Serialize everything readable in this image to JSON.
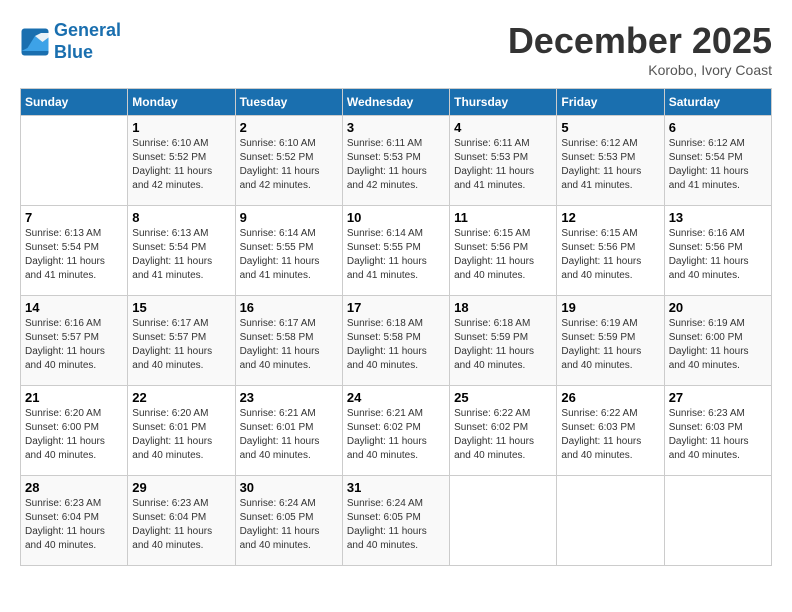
{
  "header": {
    "logo_line1": "General",
    "logo_line2": "Blue",
    "month": "December 2025",
    "location": "Korobo, Ivory Coast"
  },
  "days_of_week": [
    "Sunday",
    "Monday",
    "Tuesday",
    "Wednesday",
    "Thursday",
    "Friday",
    "Saturday"
  ],
  "weeks": [
    [
      {
        "day": "",
        "sunrise": "",
        "sunset": "",
        "daylight": ""
      },
      {
        "day": "1",
        "sunrise": "Sunrise: 6:10 AM",
        "sunset": "Sunset: 5:52 PM",
        "daylight": "Daylight: 11 hours and 42 minutes."
      },
      {
        "day": "2",
        "sunrise": "Sunrise: 6:10 AM",
        "sunset": "Sunset: 5:52 PM",
        "daylight": "Daylight: 11 hours and 42 minutes."
      },
      {
        "day": "3",
        "sunrise": "Sunrise: 6:11 AM",
        "sunset": "Sunset: 5:53 PM",
        "daylight": "Daylight: 11 hours and 42 minutes."
      },
      {
        "day": "4",
        "sunrise": "Sunrise: 6:11 AM",
        "sunset": "Sunset: 5:53 PM",
        "daylight": "Daylight: 11 hours and 41 minutes."
      },
      {
        "day": "5",
        "sunrise": "Sunrise: 6:12 AM",
        "sunset": "Sunset: 5:53 PM",
        "daylight": "Daylight: 11 hours and 41 minutes."
      },
      {
        "day": "6",
        "sunrise": "Sunrise: 6:12 AM",
        "sunset": "Sunset: 5:54 PM",
        "daylight": "Daylight: 11 hours and 41 minutes."
      }
    ],
    [
      {
        "day": "7",
        "sunrise": "Sunrise: 6:13 AM",
        "sunset": "Sunset: 5:54 PM",
        "daylight": "Daylight: 11 hours and 41 minutes."
      },
      {
        "day": "8",
        "sunrise": "Sunrise: 6:13 AM",
        "sunset": "Sunset: 5:54 PM",
        "daylight": "Daylight: 11 hours and 41 minutes."
      },
      {
        "day": "9",
        "sunrise": "Sunrise: 6:14 AM",
        "sunset": "Sunset: 5:55 PM",
        "daylight": "Daylight: 11 hours and 41 minutes."
      },
      {
        "day": "10",
        "sunrise": "Sunrise: 6:14 AM",
        "sunset": "Sunset: 5:55 PM",
        "daylight": "Daylight: 11 hours and 41 minutes."
      },
      {
        "day": "11",
        "sunrise": "Sunrise: 6:15 AM",
        "sunset": "Sunset: 5:56 PM",
        "daylight": "Daylight: 11 hours and 40 minutes."
      },
      {
        "day": "12",
        "sunrise": "Sunrise: 6:15 AM",
        "sunset": "Sunset: 5:56 PM",
        "daylight": "Daylight: 11 hours and 40 minutes."
      },
      {
        "day": "13",
        "sunrise": "Sunrise: 6:16 AM",
        "sunset": "Sunset: 5:56 PM",
        "daylight": "Daylight: 11 hours and 40 minutes."
      }
    ],
    [
      {
        "day": "14",
        "sunrise": "Sunrise: 6:16 AM",
        "sunset": "Sunset: 5:57 PM",
        "daylight": "Daylight: 11 hours and 40 minutes."
      },
      {
        "day": "15",
        "sunrise": "Sunrise: 6:17 AM",
        "sunset": "Sunset: 5:57 PM",
        "daylight": "Daylight: 11 hours and 40 minutes."
      },
      {
        "day": "16",
        "sunrise": "Sunrise: 6:17 AM",
        "sunset": "Sunset: 5:58 PM",
        "daylight": "Daylight: 11 hours and 40 minutes."
      },
      {
        "day": "17",
        "sunrise": "Sunrise: 6:18 AM",
        "sunset": "Sunset: 5:58 PM",
        "daylight": "Daylight: 11 hours and 40 minutes."
      },
      {
        "day": "18",
        "sunrise": "Sunrise: 6:18 AM",
        "sunset": "Sunset: 5:59 PM",
        "daylight": "Daylight: 11 hours and 40 minutes."
      },
      {
        "day": "19",
        "sunrise": "Sunrise: 6:19 AM",
        "sunset": "Sunset: 5:59 PM",
        "daylight": "Daylight: 11 hours and 40 minutes."
      },
      {
        "day": "20",
        "sunrise": "Sunrise: 6:19 AM",
        "sunset": "Sunset: 6:00 PM",
        "daylight": "Daylight: 11 hours and 40 minutes."
      }
    ],
    [
      {
        "day": "21",
        "sunrise": "Sunrise: 6:20 AM",
        "sunset": "Sunset: 6:00 PM",
        "daylight": "Daylight: 11 hours and 40 minutes."
      },
      {
        "day": "22",
        "sunrise": "Sunrise: 6:20 AM",
        "sunset": "Sunset: 6:01 PM",
        "daylight": "Daylight: 11 hours and 40 minutes."
      },
      {
        "day": "23",
        "sunrise": "Sunrise: 6:21 AM",
        "sunset": "Sunset: 6:01 PM",
        "daylight": "Daylight: 11 hours and 40 minutes."
      },
      {
        "day": "24",
        "sunrise": "Sunrise: 6:21 AM",
        "sunset": "Sunset: 6:02 PM",
        "daylight": "Daylight: 11 hours and 40 minutes."
      },
      {
        "day": "25",
        "sunrise": "Sunrise: 6:22 AM",
        "sunset": "Sunset: 6:02 PM",
        "daylight": "Daylight: 11 hours and 40 minutes."
      },
      {
        "day": "26",
        "sunrise": "Sunrise: 6:22 AM",
        "sunset": "Sunset: 6:03 PM",
        "daylight": "Daylight: 11 hours and 40 minutes."
      },
      {
        "day": "27",
        "sunrise": "Sunrise: 6:23 AM",
        "sunset": "Sunset: 6:03 PM",
        "daylight": "Daylight: 11 hours and 40 minutes."
      }
    ],
    [
      {
        "day": "28",
        "sunrise": "Sunrise: 6:23 AM",
        "sunset": "Sunset: 6:04 PM",
        "daylight": "Daylight: 11 hours and 40 minutes."
      },
      {
        "day": "29",
        "sunrise": "Sunrise: 6:23 AM",
        "sunset": "Sunset: 6:04 PM",
        "daylight": "Daylight: 11 hours and 40 minutes."
      },
      {
        "day": "30",
        "sunrise": "Sunrise: 6:24 AM",
        "sunset": "Sunset: 6:05 PM",
        "daylight": "Daylight: 11 hours and 40 minutes."
      },
      {
        "day": "31",
        "sunrise": "Sunrise: 6:24 AM",
        "sunset": "Sunset: 6:05 PM",
        "daylight": "Daylight: 11 hours and 40 minutes."
      },
      {
        "day": "",
        "sunrise": "",
        "sunset": "",
        "daylight": ""
      },
      {
        "day": "",
        "sunrise": "",
        "sunset": "",
        "daylight": ""
      },
      {
        "day": "",
        "sunrise": "",
        "sunset": "",
        "daylight": ""
      }
    ]
  ]
}
